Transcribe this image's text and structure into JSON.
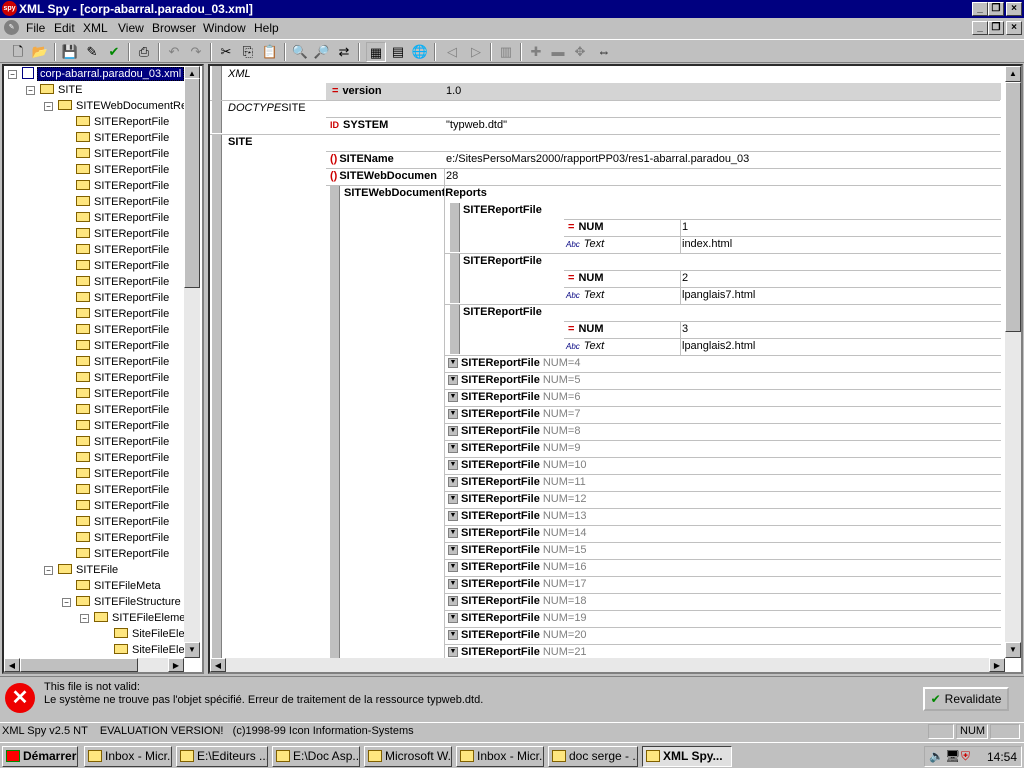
{
  "app": {
    "title": "XML Spy - [corp-abarral.paradou_03.xml]",
    "icon": "xmlspy-icon"
  },
  "menu": [
    "File",
    "Edit",
    "XML",
    "View",
    "Browser",
    "Window",
    "Help"
  ],
  "tree": {
    "root": "corp-abarral.paradou_03.xml",
    "site": "SITE",
    "webreports": "SITEWebDocumentRep",
    "report_file": "SITEReportFile",
    "report_count": 28,
    "sitefile": "SITEFile",
    "sitefilemeta": "SITEFileMeta",
    "sitefilestructure": "SITEFileStructure",
    "sitefileelement": "SITEFileElemen",
    "sitefileeler": "SiteFileEler"
  },
  "grid": {
    "xml_label": "XML",
    "version_name": "version",
    "version_value": "1.0",
    "doctype_label": "DOCTYPE",
    "doctype_name": "SITE",
    "system_name": "SYSTEM",
    "system_value": "\"typweb.dtd\"",
    "site": "SITE",
    "sitename_name": "SITEName",
    "sitename_value": "e:/SitesPersoMars2000/rapportPP03/res1-abarral.paradou_03",
    "sitewebdoc_name": "SITEWebDocumen",
    "sitewebdoc_value": "28",
    "reports_name": "SITEWebDocumentReports",
    "report_name": "SITEReportFile",
    "num_name": "NUM",
    "text_name": "Text",
    "expanded": [
      {
        "num": "1",
        "text": "index.html"
      },
      {
        "num": "2",
        "text": "lpanglais7.html"
      },
      {
        "num": "3",
        "text": "lpanglais2.html"
      }
    ],
    "collapsed": [
      "NUM=4",
      "NUM=5",
      "NUM=6",
      "NUM=7",
      "NUM=8",
      "NUM=9",
      "NUM=10",
      "NUM=11",
      "NUM=12",
      "NUM=13",
      "NUM=14",
      "NUM=15",
      "NUM=16",
      "NUM=17",
      "NUM=18",
      "NUM=19",
      "NUM=20",
      "NUM=21"
    ]
  },
  "status": {
    "error_title": "This file is not valid:",
    "error_detail": "Le système ne trouve pas l'objet spécifié. Erreur de traitement de la ressource typweb.dtd.",
    "revalidate": "Revalidate",
    "bar_text": "XML Spy v2.5 NT    EVALUATION VERSION!   (c)1998-99 Icon Information-Systems",
    "num": "NUM"
  },
  "taskbar": {
    "start": "Démarrer",
    "tasks": [
      "Inbox - Micr...",
      "E:\\Editeurs ...",
      "E:\\Doc Asp...",
      "Microsoft W...",
      "Inbox - Micr...",
      "doc serge - ...",
      "XML Spy..."
    ],
    "clock": "14:54"
  }
}
